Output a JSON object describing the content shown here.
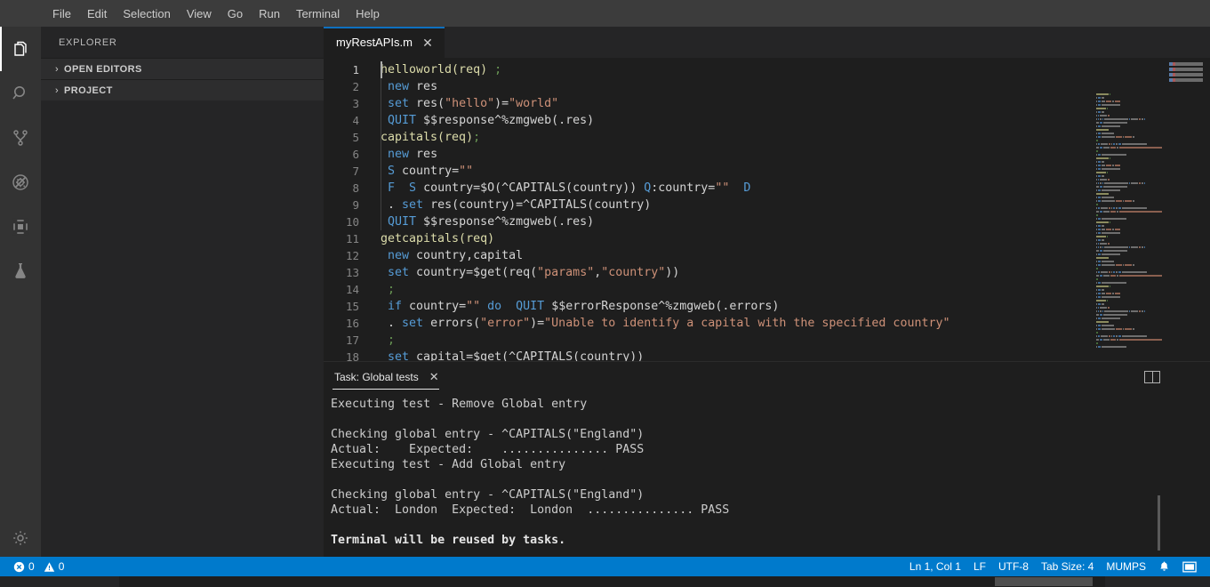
{
  "menu": {
    "items": [
      "File",
      "Edit",
      "Selection",
      "View",
      "Go",
      "Run",
      "Terminal",
      "Help"
    ]
  },
  "activity_bar": {
    "icons": [
      {
        "name": "explorer-icon",
        "active": true
      },
      {
        "name": "search-icon",
        "active": false
      },
      {
        "name": "source-control-icon",
        "active": false
      },
      {
        "name": "run-and-debug-icon",
        "active": false
      },
      {
        "name": "extensions-icon",
        "active": false
      },
      {
        "name": "testing-flask-icon",
        "active": false
      },
      {
        "name": "settings-gear-icon",
        "active": false
      }
    ]
  },
  "sidebar": {
    "title": "EXPLORER",
    "sections": [
      {
        "label": "OPEN EDITORS",
        "chevron": "›"
      },
      {
        "label": "PROJECT",
        "chevron": "›"
      }
    ]
  },
  "editor": {
    "tab": {
      "label": "myRestAPIs.m",
      "close": "✕"
    },
    "cursor_line": 1,
    "lines": [
      {
        "n": 1,
        "tokens": [
          {
            "t": "helloworld(req) ",
            "c": "lbl"
          },
          {
            "t": ";",
            "c": "c"
          }
        ]
      },
      {
        "n": 2,
        "tokens": [
          {
            "t": " ",
            "c": "pl"
          },
          {
            "t": "new",
            "c": "k"
          },
          {
            "t": " res",
            "c": "pl"
          }
        ]
      },
      {
        "n": 3,
        "tokens": [
          {
            "t": " ",
            "c": "pl"
          },
          {
            "t": "set",
            "c": "k"
          },
          {
            "t": " res(",
            "c": "pl"
          },
          {
            "t": "\"hello\"",
            "c": "s"
          },
          {
            "t": ")=",
            "c": "pl"
          },
          {
            "t": "\"world\"",
            "c": "s"
          }
        ]
      },
      {
        "n": 4,
        "tokens": [
          {
            "t": " ",
            "c": "pl"
          },
          {
            "t": "QUIT",
            "c": "k"
          },
          {
            "t": " $$response^%zmgweb(.res)",
            "c": "pl"
          }
        ]
      },
      {
        "n": 5,
        "tokens": [
          {
            "t": "capitals(req)",
            "c": "lbl"
          },
          {
            "t": ";",
            "c": "c"
          }
        ]
      },
      {
        "n": 6,
        "tokens": [
          {
            "t": " ",
            "c": "pl"
          },
          {
            "t": "new",
            "c": "k"
          },
          {
            "t": " res",
            "c": "pl"
          }
        ]
      },
      {
        "n": 7,
        "tokens": [
          {
            "t": " ",
            "c": "pl"
          },
          {
            "t": "S",
            "c": "k"
          },
          {
            "t": " country=",
            "c": "pl"
          },
          {
            "t": "\"\"",
            "c": "s"
          }
        ]
      },
      {
        "n": 8,
        "tokens": [
          {
            "t": " ",
            "c": "pl"
          },
          {
            "t": "F",
            "c": "k"
          },
          {
            "t": "  ",
            "c": "pl"
          },
          {
            "t": "S",
            "c": "k"
          },
          {
            "t": " country=$O(^CAPITALS(country)) ",
            "c": "pl"
          },
          {
            "t": "Q",
            "c": "k"
          },
          {
            "t": ":country=",
            "c": "pl"
          },
          {
            "t": "\"\"",
            "c": "s"
          },
          {
            "t": "  ",
            "c": "pl"
          },
          {
            "t": "D",
            "c": "k"
          }
        ]
      },
      {
        "n": 9,
        "tokens": [
          {
            "t": " . ",
            "c": "pl"
          },
          {
            "t": "set",
            "c": "k"
          },
          {
            "t": " res(country)=^CAPITALS(country)",
            "c": "pl"
          }
        ]
      },
      {
        "n": 10,
        "tokens": [
          {
            "t": " ",
            "c": "pl"
          },
          {
            "t": "QUIT",
            "c": "k"
          },
          {
            "t": " $$response^%zmgweb(.res)",
            "c": "pl"
          }
        ]
      },
      {
        "n": 11,
        "tokens": [
          {
            "t": "getcapitals(req)",
            "c": "lbl"
          }
        ]
      },
      {
        "n": 12,
        "tokens": [
          {
            "t": " ",
            "c": "pl"
          },
          {
            "t": "new",
            "c": "k"
          },
          {
            "t": " country,capital",
            "c": "pl"
          }
        ]
      },
      {
        "n": 13,
        "tokens": [
          {
            "t": " ",
            "c": "pl"
          },
          {
            "t": "set",
            "c": "k"
          },
          {
            "t": " country=$get(req(",
            "c": "pl"
          },
          {
            "t": "\"params\"",
            "c": "s"
          },
          {
            "t": ",",
            "c": "pl"
          },
          {
            "t": "\"country\"",
            "c": "s"
          },
          {
            "t": "))",
            "c": "pl"
          }
        ]
      },
      {
        "n": 14,
        "tokens": [
          {
            "t": " ;",
            "c": "c"
          }
        ]
      },
      {
        "n": 15,
        "tokens": [
          {
            "t": " ",
            "c": "pl"
          },
          {
            "t": "if",
            "c": "k"
          },
          {
            "t": " country=",
            "c": "pl"
          },
          {
            "t": "\"\"",
            "c": "s"
          },
          {
            "t": " ",
            "c": "pl"
          },
          {
            "t": "do",
            "c": "k"
          },
          {
            "t": "  ",
            "c": "pl"
          },
          {
            "t": "QUIT",
            "c": "k"
          },
          {
            "t": " $$errorResponse^%zmgweb(.errors)",
            "c": "pl"
          }
        ]
      },
      {
        "n": 16,
        "tokens": [
          {
            "t": " . ",
            "c": "pl"
          },
          {
            "t": "set",
            "c": "k"
          },
          {
            "t": " errors(",
            "c": "pl"
          },
          {
            "t": "\"error\"",
            "c": "s"
          },
          {
            "t": ")=",
            "c": "pl"
          },
          {
            "t": "\"Unable to identify a capital with the specified country\"",
            "c": "s"
          }
        ]
      },
      {
        "n": 17,
        "tokens": [
          {
            "t": " ;",
            "c": "c"
          }
        ]
      },
      {
        "n": 18,
        "tokens": [
          {
            "t": " ",
            "c": "pl"
          },
          {
            "t": "set",
            "c": "k"
          },
          {
            "t": " capital=$get(^CAPITALS(country))",
            "c": "pl"
          }
        ]
      }
    ]
  },
  "panel": {
    "tab_label": "Task: Global tests",
    "tab_close": "✕",
    "split_icon": "split-terminal-icon",
    "terminal_lines": [
      {
        "text": "Executing test - Remove Global entry",
        "bold": false
      },
      {
        "text": "",
        "bold": false
      },
      {
        "text": "Checking global entry - ^CAPITALS(\"England\")",
        "bold": false
      },
      {
        "text": "Actual:    Expected:    ............... PASS",
        "bold": false
      },
      {
        "text": "Executing test - Add Global entry",
        "bold": false
      },
      {
        "text": "",
        "bold": false
      },
      {
        "text": "Checking global entry - ^CAPITALS(\"England\")",
        "bold": false
      },
      {
        "text": "Actual:  London  Expected:  London  ............... PASS",
        "bold": false
      },
      {
        "text": "",
        "bold": false
      },
      {
        "text": "Terminal will be reused by tasks.",
        "bold": true
      }
    ]
  },
  "statusbar": {
    "errors": "0",
    "warnings": "0",
    "position": "Ln 1, Col 1",
    "eol": "LF",
    "encoding": "UTF-8",
    "tab_size": "Tab Size: 4",
    "language": "MUMPS",
    "bell_icon": "notifications-bell-icon",
    "layout_icon": "panel-layout-icon",
    "accent": "#007acc"
  }
}
